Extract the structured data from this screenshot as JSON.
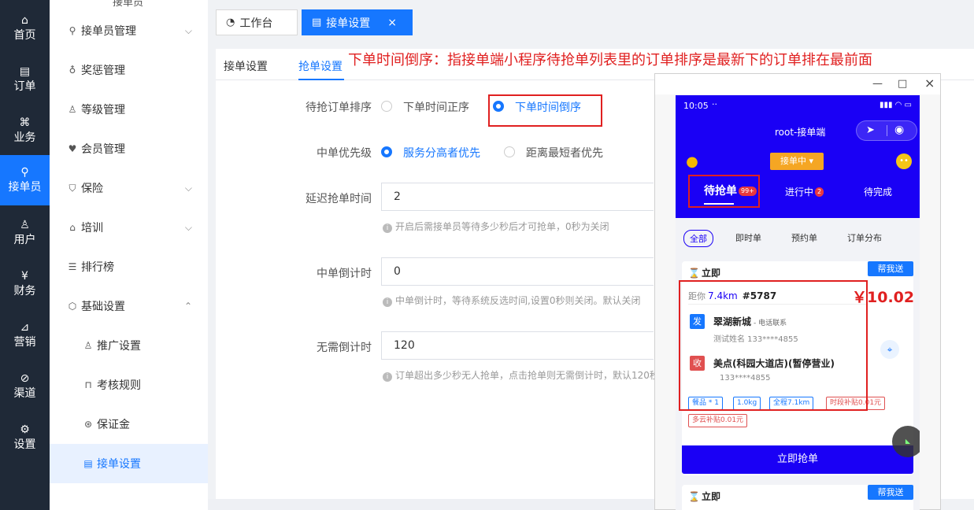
{
  "nav": {
    "items": [
      {
        "label": "首页",
        "icon": "home-icon"
      },
      {
        "label": "订单",
        "icon": "order-icon"
      },
      {
        "label": "业务",
        "icon": "grid-icon"
      },
      {
        "label": "接单员",
        "icon": "bike-icon"
      },
      {
        "label": "用户",
        "icon": "user-icon"
      },
      {
        "label": "财务",
        "icon": "yuan-icon"
      },
      {
        "label": "营销",
        "icon": "chart-icon"
      },
      {
        "label": "渠道",
        "icon": "compass-icon"
      },
      {
        "label": "设置",
        "icon": "settings-icon"
      }
    ],
    "active_label": "接单员"
  },
  "sidebar": {
    "top_label": "接单员",
    "items": [
      {
        "label": "接单员管理"
      },
      {
        "label": "奖惩管理"
      },
      {
        "label": "等级管理"
      },
      {
        "label": "会员管理"
      },
      {
        "label": "保险"
      },
      {
        "label": "培训"
      },
      {
        "label": "排行榜"
      },
      {
        "label": "基础设置"
      },
      {
        "label": "推广设置"
      },
      {
        "label": "考核规则"
      },
      {
        "label": "保证金"
      },
      {
        "label": "接单设置"
      }
    ],
    "active_label": "接单设置"
  },
  "topbar": {
    "tab_workbench": "工作台",
    "tab_order_settings": "接单设置",
    "close_glyph": "×"
  },
  "subtabs": {
    "tab1": "接单设置",
    "tab2": "抢单设置"
  },
  "annotation": "下单时间倒序：指接单端小程序待抢单列表里的订单排序是最新下的订单排在最前面",
  "form": {
    "sort_label": "待抢订单排序",
    "sort_opt1": "下单时间正序",
    "sort_opt2": "下单时间倒序",
    "priority_label": "中单优先级",
    "priority_opt1": "服务分高者优先",
    "priority_opt2": "距离最短者优先",
    "delay_label": "延迟抢单时间",
    "delay_value": "2",
    "delay_hint": "开启后需接单员等待多少秒后才可抢单，0秒为关闭",
    "countdown_label": "中单倒计时",
    "countdown_value": "0",
    "countdown_hint": "中单倒计时，等待系统反选时间,设置0秒则关闭。默认关闭",
    "nocount_label": "无需倒计时",
    "nocount_value": "120",
    "nocount_hint": "订单超出多少秒无人抢单，点击抢单则无需倒计时，默认120秒"
  },
  "window": {
    "minimize": "—",
    "maximize": "□",
    "close": "×"
  },
  "phone": {
    "time": "10:05",
    "dots": "··",
    "title": "root-接单端",
    "status_button": "接单中 ▾",
    "tabs": {
      "pending": "待抢单",
      "pending_badge": "99+",
      "in_progress": "进行中",
      "in_progress_badge": "2",
      "to_complete": "待完成"
    },
    "filters": [
      "全部",
      "即时单",
      "预约单",
      "订单分布"
    ],
    "card1": {
      "title": "立即",
      "help_button": "帮我送",
      "dist_prefix": "距你",
      "distance": "7.4km",
      "order_no": "#5787",
      "price": "￥10.02",
      "send_tag": "发",
      "send_name": "翠湖新城",
      "send_contact": "- 电话联系",
      "send_sub": "测试姓名  133****4855",
      "recv_tag": "收",
      "recv_name": "美点(科园大道店)(暂停营业)",
      "recv_sub": "133****4855",
      "chips": [
        "餐品 * 1",
        "1.0kg",
        "全程7.1km",
        "时段补贴0.01元",
        "多云补贴0.01元"
      ],
      "grab_button": "立即抢单"
    },
    "card2": {
      "title": "立即",
      "help_button": "帮我送"
    }
  },
  "colors": {
    "accent": "#1677ff",
    "phone_brand": "#1a00f5",
    "annotation_red": "#e02020",
    "nav_bg": "#1f2937"
  }
}
